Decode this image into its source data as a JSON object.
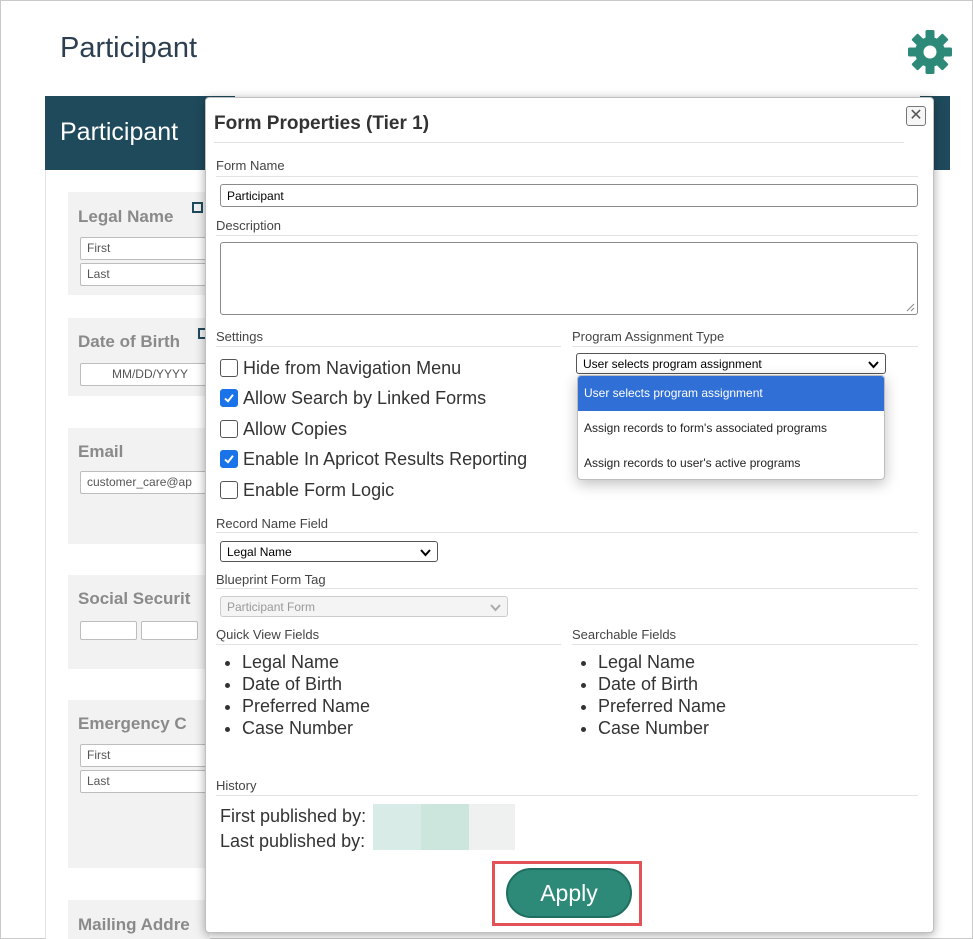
{
  "page": {
    "title": "Participant"
  },
  "background": {
    "header_title": "Participant",
    "cards": [
      {
        "label": "Legal Name",
        "inputs": [
          "First",
          "Last"
        ]
      },
      {
        "label": "Date of Birth",
        "inputs": [
          "MM/DD/YYYY"
        ]
      },
      {
        "label": "Email",
        "inputs": [
          "customer_care@ap"
        ]
      },
      {
        "label": "Social Securit",
        "inputs": [
          "",
          ""
        ]
      },
      {
        "label": "Emergency C",
        "inputs": [
          "First",
          "Last"
        ]
      },
      {
        "label": "Mailing Addre",
        "inputs": []
      }
    ]
  },
  "modal": {
    "title": "Form Properties (Tier 1)",
    "form_name_label": "Form Name",
    "form_name_value": "Participant",
    "description_label": "Description",
    "description_value": "",
    "settings_label": "Settings",
    "settings": [
      {
        "label": "Hide from Navigation Menu",
        "checked": false
      },
      {
        "label": "Allow Search by Linked Forms",
        "checked": true
      },
      {
        "label": "Allow Copies",
        "checked": false
      },
      {
        "label": "Enable In Apricot Results Reporting",
        "checked": true
      },
      {
        "label": "Enable Form Logic",
        "checked": false
      }
    ],
    "program_assignment_label": "Program Assignment Type",
    "program_assignment_selected": "User selects program assignment",
    "program_assignment_options": [
      "User selects program assignment",
      "Assign records to form's associated programs",
      "Assign records to user's active programs"
    ],
    "record_name_label": "Record Name Field",
    "record_name_value": "Legal Name",
    "blueprint_label": "Blueprint Form Tag",
    "blueprint_value": "Participant Form",
    "quick_view_label": "Quick View Fields",
    "quick_view_fields": [
      "Legal Name",
      "Date of Birth",
      "Preferred Name",
      "Case Number"
    ],
    "searchable_label": "Searchable Fields",
    "searchable_fields": [
      "Legal Name",
      "Date of Birth",
      "Preferred Name",
      "Case Number"
    ],
    "history_label": "History",
    "first_published_label": "First published by:",
    "last_published_label": "Last published by:",
    "apply_label": "Apply"
  },
  "colors": {
    "accent_teal": "#2e8a78",
    "header_navy": "#1f4a5c",
    "highlight_red": "#e25256",
    "checkbox_blue": "#1a73e8"
  }
}
